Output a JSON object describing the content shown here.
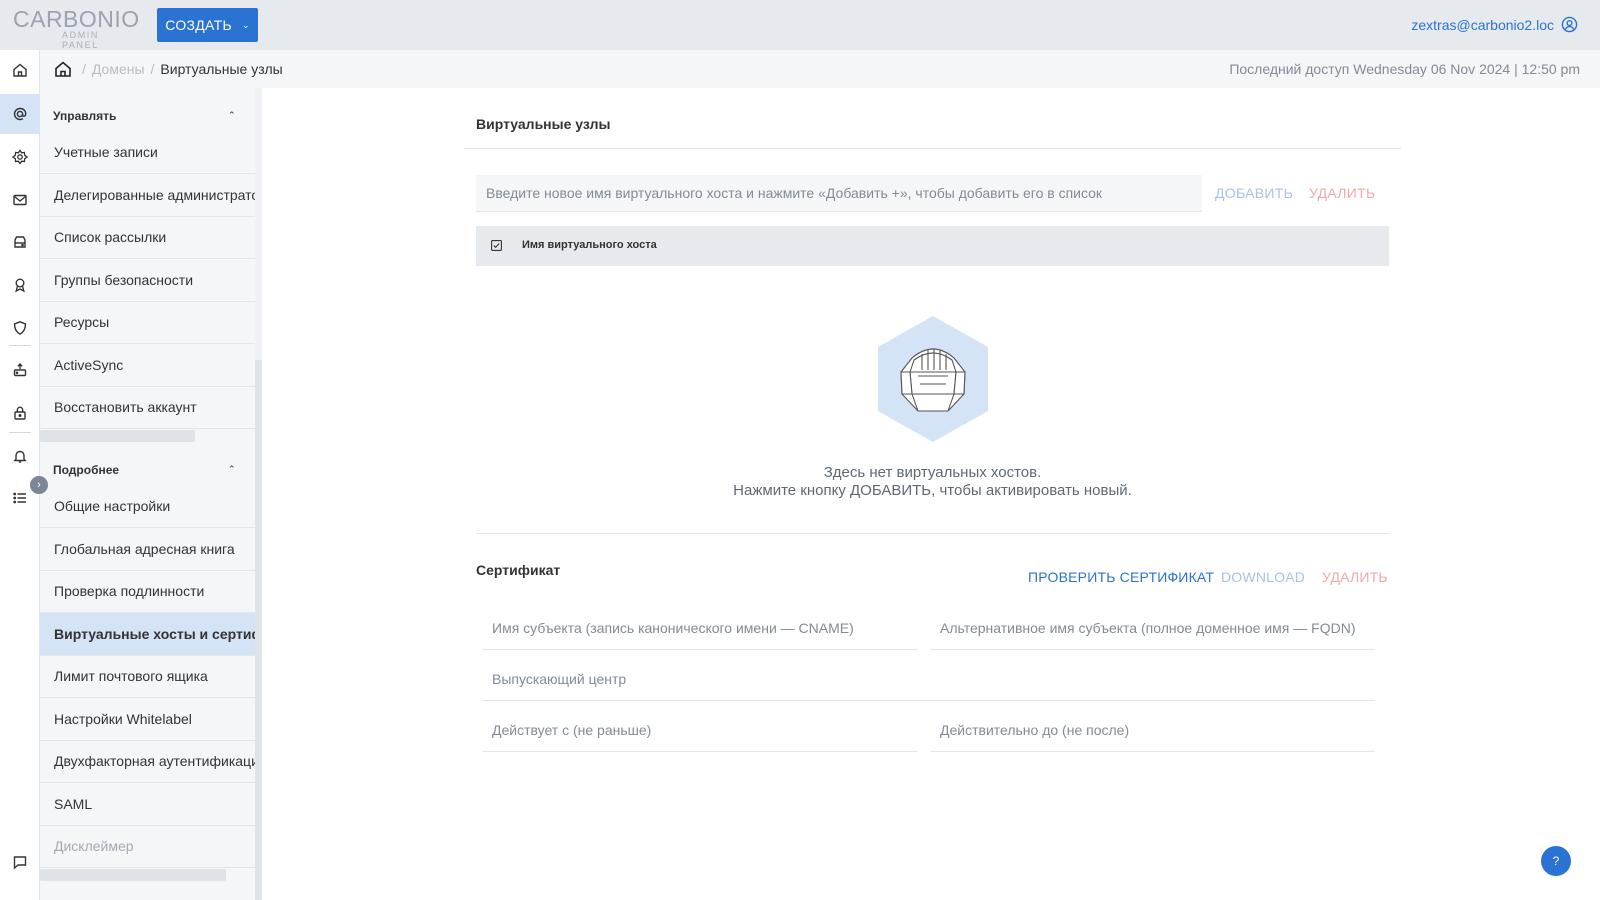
{
  "header": {
    "logo_brand": "CARBONIO",
    "logo_sub": "ADMIN PANEL",
    "create_label": "СОЗДАТЬ",
    "user_email": "zextras@carbonio2.loc"
  },
  "rail": {
    "icons": [
      "home-icon",
      "at-sign-icon",
      "gear-flower-icon",
      "mail-icon",
      "storage-icon",
      "award-icon",
      "shield-icon",
      "backup-icon",
      "lock-icon",
      "bell-icon",
      "list-icon",
      "chat-icon"
    ]
  },
  "breadcrumb": {
    "parent": "Домены",
    "current": "Виртуальные узлы",
    "last_access": "Последний доступ Wednesday 06 Nov 2024 | 12:50 pm"
  },
  "sidenav": {
    "manage_title": "Управлять",
    "manage_items": [
      "Учетные записи",
      "Делегированные администрато",
      "Список рассылки",
      "Группы безопасности",
      "Ресурсы",
      "ActiveSync",
      "Восстановить аккаунт"
    ],
    "details_title": "Подробнее",
    "details_items": [
      "Общие настройки",
      "Глобальная адресная книга",
      "Проверка подлинности",
      "Виртуальные хосты и сертифик",
      "Лимит почтового ящика",
      "Настройки Whitelabel",
      "Двухфакторная аутентификация",
      "SAML",
      "Дисклеймер"
    ],
    "active_item": "Виртуальные хосты и сертифик"
  },
  "virtual_hosts": {
    "title": "Виртуальные узлы",
    "input_placeholder": "Введите новое имя виртуального хоста и нажмите «Добавить +», чтобы добавить его в список",
    "add_label": "ДОБАВИТЬ",
    "delete_label": "УДАЛИТЬ",
    "column_header": "Имя виртуального хоста",
    "empty_line1": "Здесь нет виртуальных хостов.",
    "empty_line2": "Нажмите кнопку ДОБАВИТЬ, чтобы активировать новый."
  },
  "certificate": {
    "title": "Сертификат",
    "verify_label": "ПРОВЕРИТЬ СЕРТИФИКАТ",
    "download_label": "DOWNLOAD",
    "delete_label": "УДАЛИТЬ",
    "subject_name": "Имя субъекта (запись канонического имени — CNAME)",
    "alt_subject_name": "Альтернативное имя субъекта (полное доменное имя — FQDN)",
    "issuer": "Выпускающий центр",
    "valid_from": "Действует с (не раньше)",
    "valid_to": "Действительно до (не после)"
  },
  "help": {
    "label": "?"
  },
  "colors": {
    "accent": "#2b73d2",
    "danger_disabled": "#f0a8a8",
    "accent_disabled": "#a6c3ea",
    "active_bg": "#d5e3f6"
  }
}
